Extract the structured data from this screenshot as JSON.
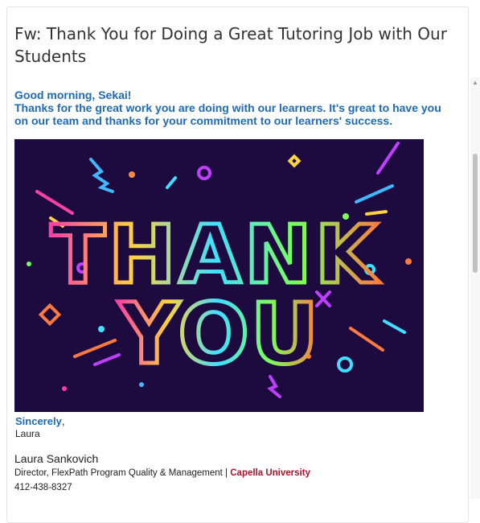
{
  "email": {
    "subject": "Fw: Thank You for Doing a Great Tutoring Job with Our Students",
    "greeting": "Good morning, Sekai!",
    "body": "Thanks for the great work you are doing with our learners. It's great to have you on our team and thanks for your commitment to our learners' success.",
    "banner": {
      "line1": "THANK",
      "line2": "YOU",
      "background": "#1d0b40"
    },
    "closing": "Sincerely",
    "closing_punct": ",",
    "closing_name": "Laura",
    "signature": {
      "name": "Laura Sankovich",
      "title": "Director, FlexPath Program Quality & Management",
      "separator": " | ",
      "university": "Capella University",
      "phone": "412-438-8327"
    }
  },
  "colors": {
    "accent_blue": "#1f6ab6",
    "university_red": "#b1122a"
  },
  "icons": {
    "scroll_up": "scroll-up-arrow-icon"
  }
}
